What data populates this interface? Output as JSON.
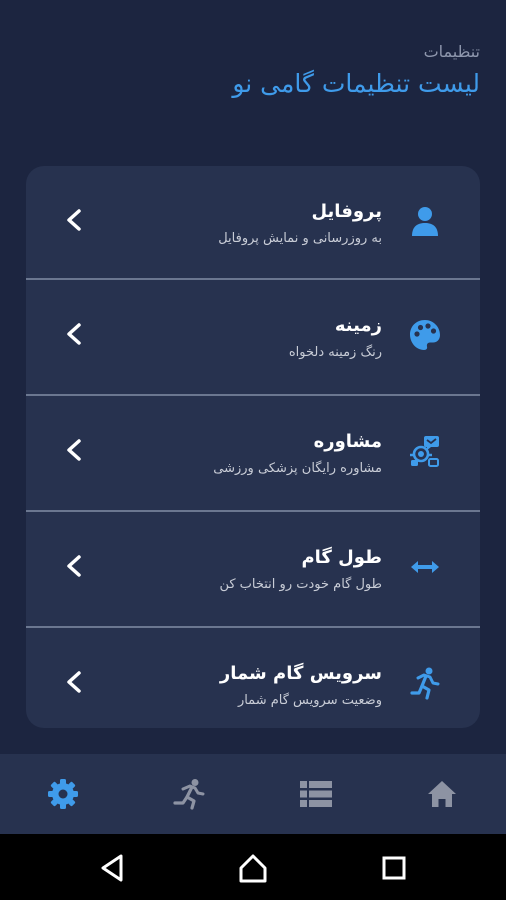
{
  "header": {
    "subtitle": "تنظیمات",
    "title": "لیست تنظیمات گامی نو"
  },
  "settings": [
    {
      "title": "پروفایل",
      "desc": "به روزرسانی و نمایش پروفایل",
      "icon": "person-icon"
    },
    {
      "title": "زمینه",
      "desc": "رنگ زمینه دلخواه",
      "icon": "palette-icon"
    },
    {
      "title": "مشاوره",
      "desc": "مشاوره رایگان پزشکی ورزشی",
      "icon": "consult-icon"
    },
    {
      "title": "طول گام",
      "desc": "طول گام خودت رو انتخاب کن",
      "icon": "step-length-icon"
    },
    {
      "title": "سرویس گام شمار",
      "desc": "وضعیت سرویس گام شمار",
      "icon": "running-icon"
    }
  ],
  "bottom_nav": {
    "active": "settings",
    "items": [
      "settings",
      "activity",
      "list",
      "home"
    ]
  },
  "colors": {
    "background": "#1c2540",
    "card": "#27324f",
    "accent": "#3f9bea",
    "nav_inactive": "#8d93a3"
  }
}
